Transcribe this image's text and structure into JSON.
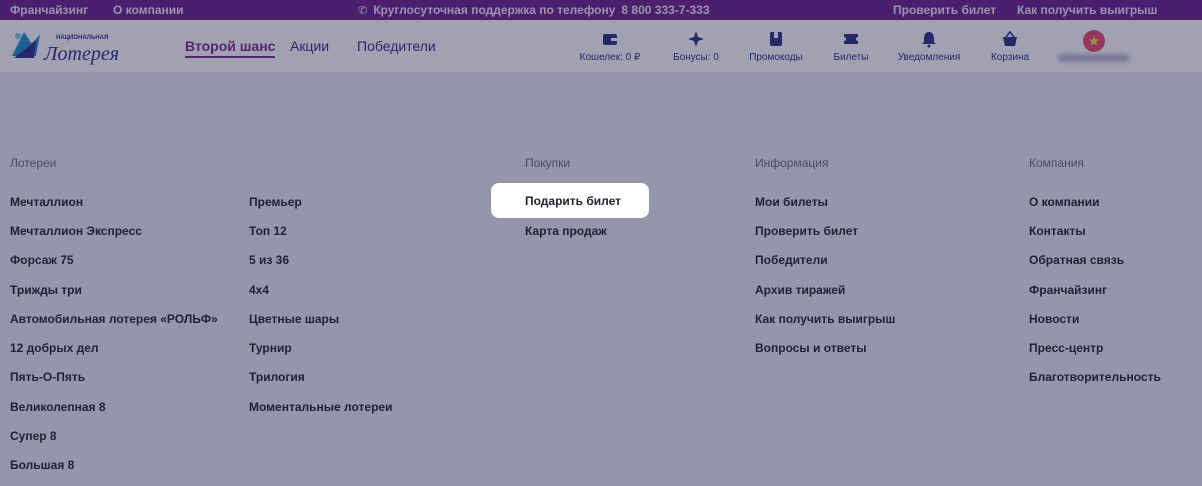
{
  "topbar": {
    "franchise": "Франчайзинг",
    "about": "О компании",
    "support": "Круглосуточная поддержка по телефону",
    "phone": "8 800 333-7-333",
    "check_ticket": "Проверить билет",
    "how_to_win": "Как получить выигрыш"
  },
  "header": {
    "logo_small": "НАЦИОНАЛЬНАЯ",
    "logo_big": "Лотерея",
    "nav": [
      "Второй шанс",
      "Акции",
      "Победители"
    ],
    "icons": [
      {
        "label": "Кошелек: 0 ₽",
        "icon": "wallet-icon"
      },
      {
        "label": "Бонусы: 0",
        "icon": "sparkle-icon"
      },
      {
        "label": "Промокоды",
        "icon": "promo-icon"
      },
      {
        "label": "Билеты",
        "icon": "ticket-icon"
      },
      {
        "label": "Уведомления",
        "icon": "bell-icon"
      },
      {
        "label": "Корзина",
        "icon": "basket-icon"
      }
    ]
  },
  "footer": {
    "lotteries": {
      "title": "Лотереи",
      "col1": [
        "Мечталлион",
        "Мечталлион Экспресс",
        "Форсаж 75",
        "Трижды три",
        "Автомобильная лотерея «РОЛЬФ»",
        "12 добрых дел",
        "Пять-О-Пять",
        "Великолепная 8",
        "Супер 8",
        "Большая 8"
      ],
      "col2": [
        "Премьер",
        "Топ 12",
        "5 из 36",
        "4х4",
        "Цветные шары",
        "Турнир",
        "Трилогия",
        "Моментальные лотереи"
      ]
    },
    "purchases": {
      "title": "Покупки",
      "items": [
        "Подарить билет",
        "Карта продаж"
      ]
    },
    "info": {
      "title": "Информация",
      "items": [
        "Мои билеты",
        "Проверить билет",
        "Победители",
        "Архив тиражей",
        "Как получить выигрыш",
        "Вопросы и ответы"
      ]
    },
    "company": {
      "title": "Компания",
      "items": [
        "О компании",
        "Контакты",
        "Обратная связь",
        "Франчайзинг",
        "Новости",
        "Пресс-центр",
        "Благотворительность"
      ]
    }
  },
  "colors": {
    "topbar": "#6b1f8a",
    "nav_text": "#2e2f86",
    "accent": "#7a2a8e",
    "overlay": "#201e48"
  }
}
